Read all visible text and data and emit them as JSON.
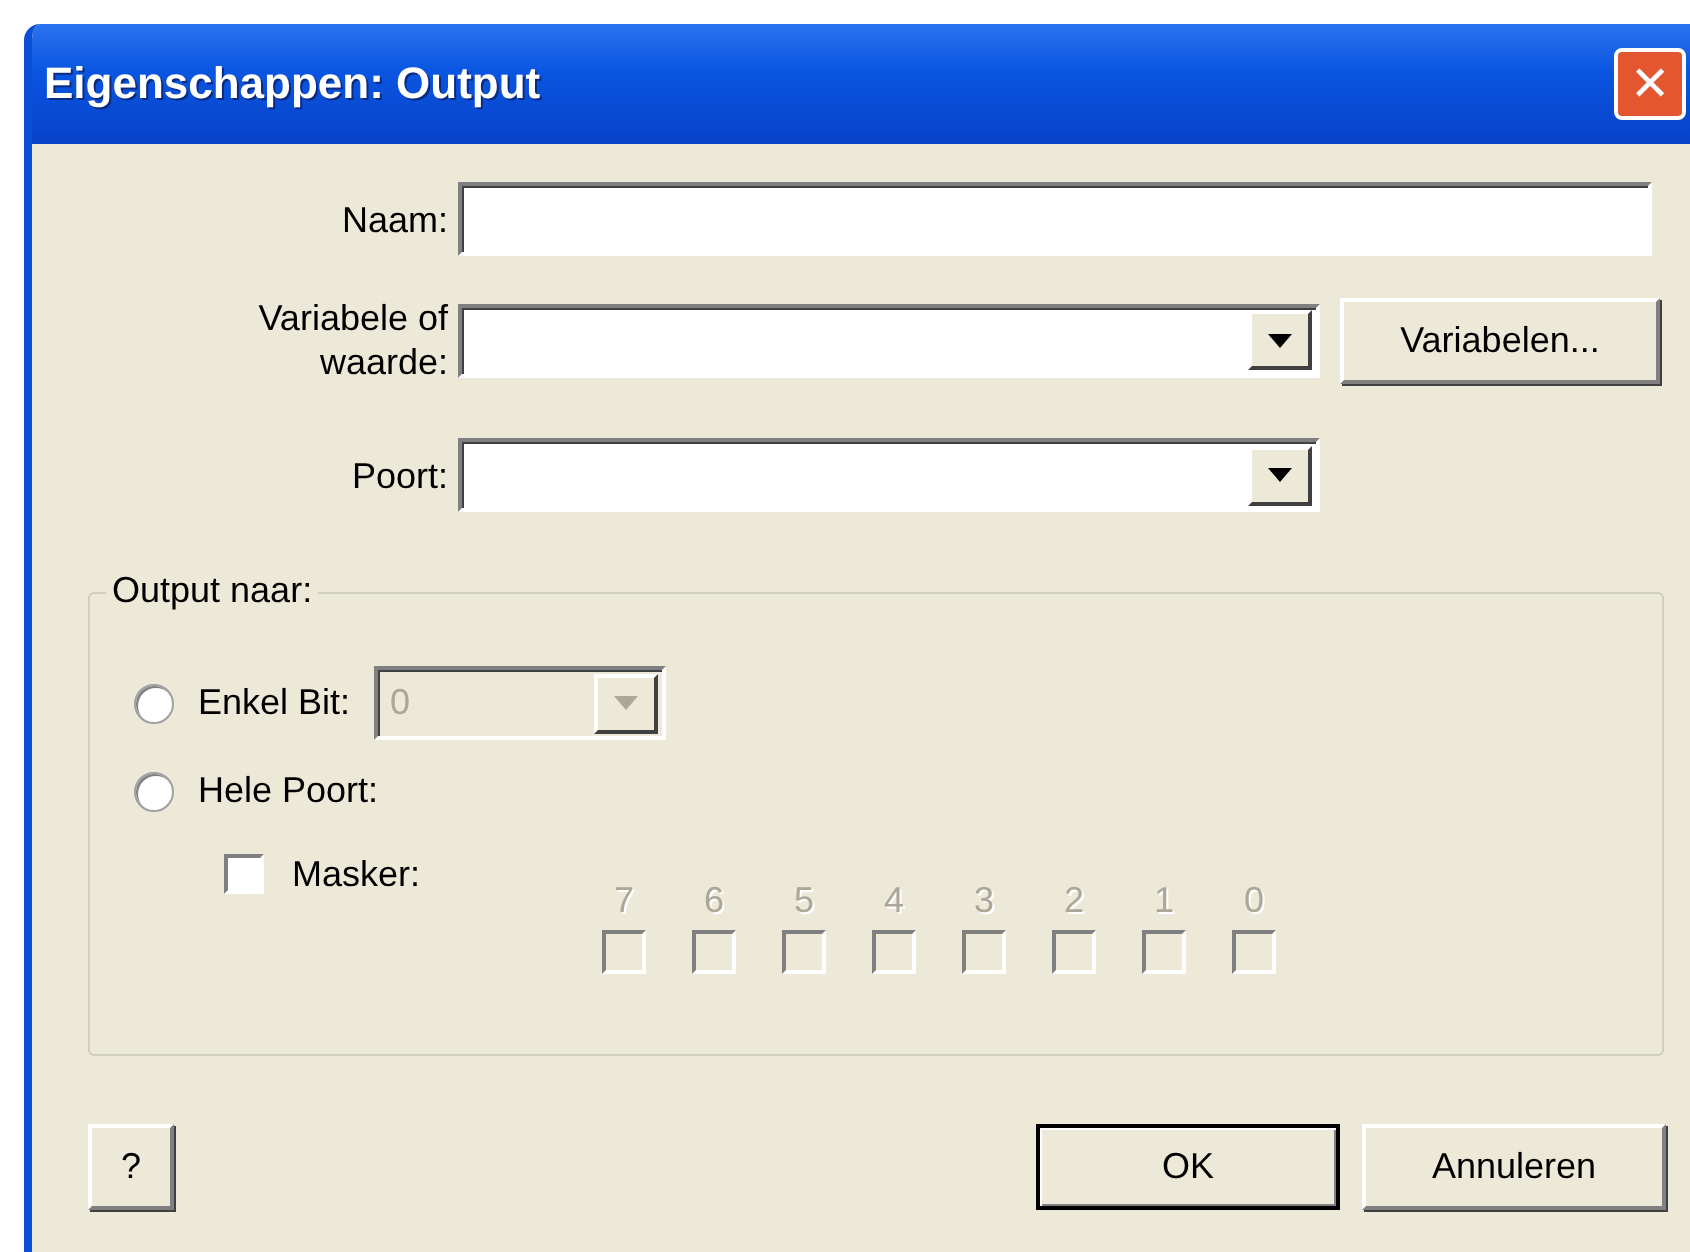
{
  "window": {
    "title": "Eigenschappen: Output",
    "close": "✕"
  },
  "fields": [
    {
      "kind": "text",
      "label": "Naam:"
    },
    {
      "kind": "combo",
      "label": "Variabele of waarde:",
      "button": "Variabelen..."
    },
    {
      "kind": "combo",
      "label": "Poort:"
    }
  ],
  "group": {
    "legend": "Output naar:",
    "options": [
      {
        "label": "Enkel Bit:",
        "selected": false
      },
      {
        "label": "Hele Poort:",
        "selected": false
      }
    ],
    "bit_combo": {
      "value": "0",
      "disabled": true
    },
    "mask": {
      "label": "Masker:",
      "checked": false
    },
    "bits": [
      {
        "label": "7",
        "checked": false,
        "disabled": true
      },
      {
        "label": "6",
        "checked": false,
        "disabled": true
      },
      {
        "label": "5",
        "checked": false,
        "disabled": true
      },
      {
        "label": "4",
        "checked": false,
        "disabled": true
      },
      {
        "label": "3",
        "checked": false,
        "disabled": true
      },
      {
        "label": "2",
        "checked": false,
        "disabled": true
      },
      {
        "label": "1",
        "checked": false,
        "disabled": true
      },
      {
        "label": "0",
        "checked": false,
        "disabled": true
      }
    ]
  },
  "buttons": [
    {
      "label": "?",
      "default": false
    },
    {
      "label": "OK",
      "default": true
    },
    {
      "label": "Annuleren",
      "default": false
    }
  ]
}
